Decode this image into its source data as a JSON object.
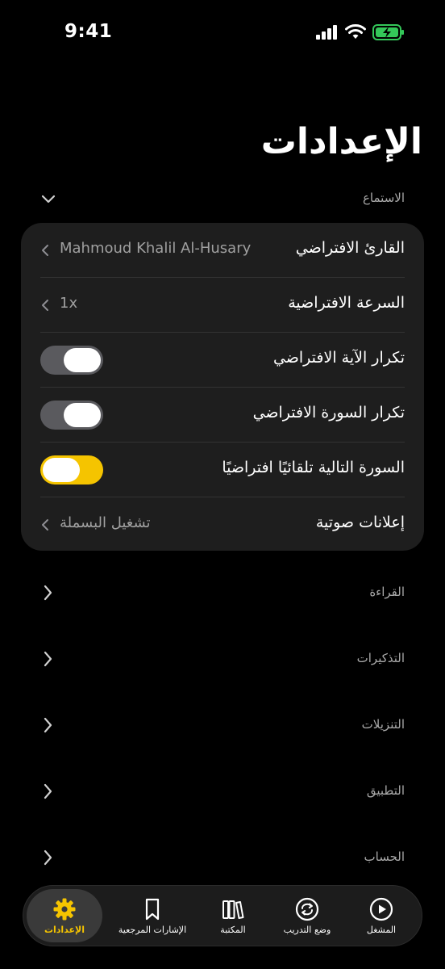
{
  "status": {
    "time": "9:41"
  },
  "page": {
    "title": "الإعدادات"
  },
  "sections": {
    "listening": "الاستماع",
    "reading": "القراءة",
    "reminders": "التذكيرات",
    "downloads": "التنزيلات",
    "app": "التطبيق",
    "account": "الحساب"
  },
  "listening": {
    "default_reciter_label": "القارئ الافتراضي",
    "default_reciter_value": "Mahmoud Khalil Al-Husary",
    "default_speed_label": "السرعة الافتراضية",
    "default_speed_value": "1x",
    "repeat_ayah_label": "تكرار الآية الافتراضي",
    "repeat_ayah_on": false,
    "repeat_surah_label": "تكرار السورة الافتراضي",
    "repeat_surah_on": false,
    "autoplay_next_label": "السورة التالية تلقائيًا افتراضيًا",
    "autoplay_next_on": true,
    "audio_announcements_label": "إعلانات صوتية",
    "audio_announcements_value": "تشغيل البسملة"
  },
  "tabs": {
    "player": "المشغل",
    "practice": "وضع التدريب",
    "library": "المكتبة",
    "bookmarks": "الإشارات المرجعية",
    "settings": "الإعدادات"
  },
  "colors": {
    "accent": "#f5c400",
    "card": "#1e1e1e",
    "background": "#000000"
  }
}
